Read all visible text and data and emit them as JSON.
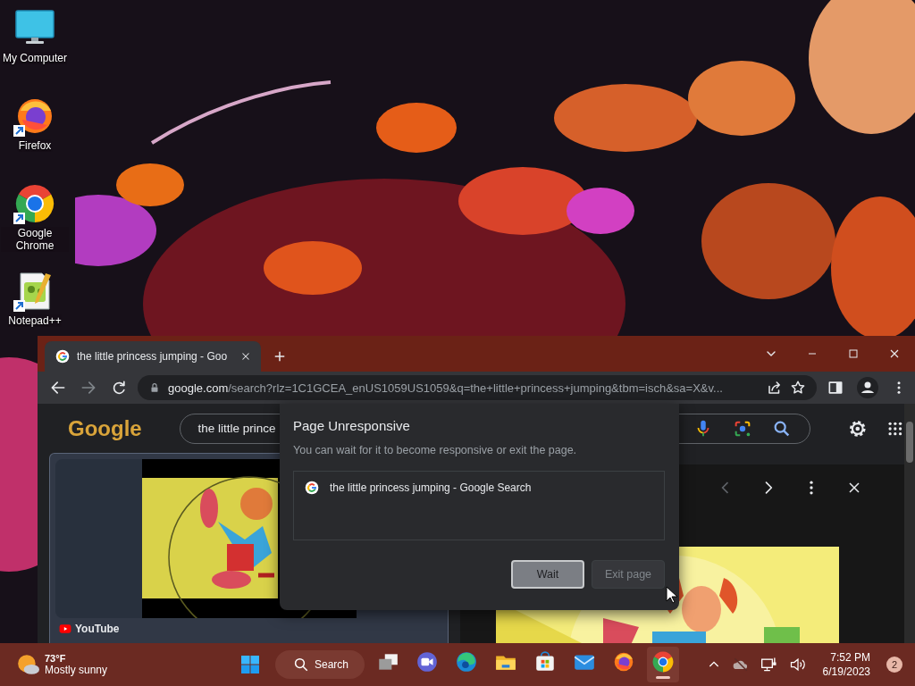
{
  "desktop_icons": [
    {
      "label": "My Computer",
      "kind": "computer",
      "shortcut": false
    },
    {
      "label": "Firefox",
      "kind": "firefox",
      "shortcut": true
    },
    {
      "label": "Google Chrome",
      "kind": "chrome",
      "shortcut": true
    },
    {
      "label": "Notepad++",
      "kind": "notepad",
      "shortcut": true
    }
  ],
  "browser": {
    "tab": {
      "title": "the little princess jumping - Goo",
      "selected": true
    },
    "url": {
      "host": "google.com",
      "path": "/search?rlz=1C1GCEA_enUS1059US1059&q=the+little+princess+jumping&tbm=isch&sa=X&v..."
    },
    "page": {
      "logo": "Google",
      "search_value": "the little prince",
      "result_source": "YouTube"
    }
  },
  "dialog": {
    "title": "Page Unresponsive",
    "message": "You can wait for it to become responsive or exit the page.",
    "pages": [
      {
        "title": "the little princess jumping - Google Search"
      }
    ],
    "buttons": [
      {
        "label": "Wait",
        "focused": true
      },
      {
        "label": "Exit page",
        "focused": false
      }
    ]
  },
  "taskbar": {
    "weather": {
      "temperature": "73°F",
      "condition": "Mostly sunny"
    },
    "search_label": "Search",
    "apps": [
      {
        "kind": "taskview",
        "selected": false
      },
      {
        "kind": "teams",
        "selected": false
      },
      {
        "kind": "edge",
        "selected": false
      },
      {
        "kind": "explorer",
        "selected": false
      },
      {
        "kind": "store",
        "selected": false
      },
      {
        "kind": "mail",
        "selected": false
      },
      {
        "kind": "firefox",
        "selected": false
      },
      {
        "kind": "chrome",
        "selected": true
      }
    ],
    "clock": {
      "time": "7:52 PM",
      "date": "6/19/2023"
    },
    "notifications": "2"
  }
}
